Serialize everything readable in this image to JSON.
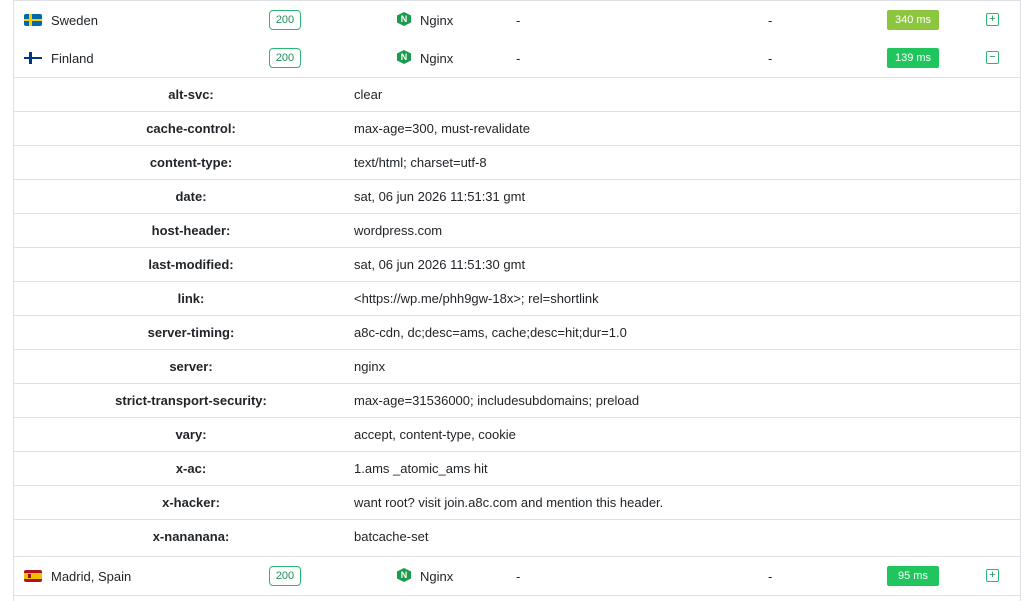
{
  "locations": [
    {
      "name": "Sweden",
      "status": "200",
      "server": "Nginx",
      "col1": "-",
      "col2": "-",
      "time": "340 ms",
      "time_color": "#8cc63f",
      "toggle": "+",
      "flag": "sweden-flag"
    },
    {
      "name": "Finland",
      "status": "200",
      "server": "Nginx",
      "col1": "-",
      "col2": "-",
      "time": "139 ms",
      "time_color": "#21c55d",
      "toggle": "−",
      "flag": "finland-flag"
    },
    {
      "name": "Madrid, Spain",
      "status": "200",
      "server": "Nginx",
      "col1": "-",
      "col2": "-",
      "time": "95 ms",
      "time_color": "#21c55d",
      "toggle": "+",
      "flag": "spain-flag"
    }
  ],
  "server_icon_letter": "N",
  "headers": [
    {
      "name": "alt-svc:",
      "value": "clear"
    },
    {
      "name": "cache-control:",
      "value": "max-age=300, must-revalidate"
    },
    {
      "name": "content-type:",
      "value": "text/html; charset=utf-8"
    },
    {
      "name": "date:",
      "value": "sat, 06 jun 2026 11:51:31 gmt"
    },
    {
      "name": "host-header:",
      "value": "wordpress.com"
    },
    {
      "name": "last-modified:",
      "value": "sat, 06 jun 2026 11:51:30 gmt"
    },
    {
      "name": "link:",
      "value": "<https://wp.me/phh9gw-18x>; rel=shortlink"
    },
    {
      "name": "server-timing:",
      "value": "a8c-cdn, dc;desc=ams, cache;desc=hit;dur=1.0"
    },
    {
      "name": "server:",
      "value": "nginx"
    },
    {
      "name": "strict-transport-security:",
      "value": "max-age=31536000; includesubdomains; preload"
    },
    {
      "name": "vary:",
      "value": "accept, content-type, cookie"
    },
    {
      "name": "x-ac:",
      "value": "1.ams _atomic_ams hit"
    },
    {
      "name": "x-hacker:",
      "value": "want root? visit join.a8c.com and mention this header."
    },
    {
      "name": "x-nananana:",
      "value": "batcache-set"
    }
  ]
}
